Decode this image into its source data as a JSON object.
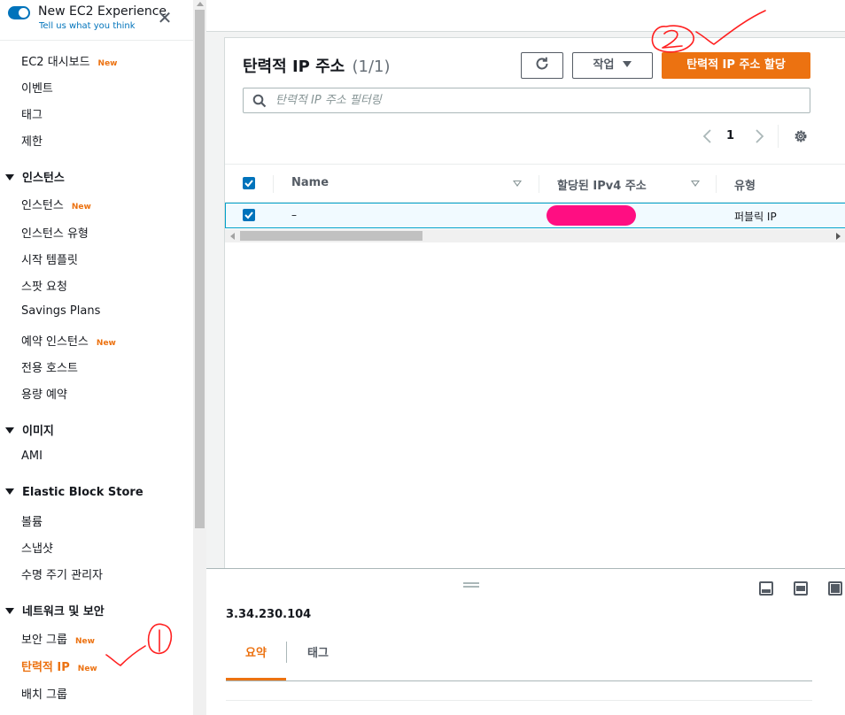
{
  "experience_toggle": {
    "title": "New EC2 Experience",
    "subtitle": "Tell us what you think"
  },
  "sidebar": {
    "items": [
      {
        "label": "EC2 대시보드",
        "badge": "New"
      },
      {
        "label": "이벤트",
        "badge": ""
      },
      {
        "label": "태그",
        "badge": ""
      },
      {
        "label": "제한",
        "badge": ""
      },
      {
        "label": "인스턴스",
        "badge": "",
        "section": true
      },
      {
        "label": "인스턴스",
        "badge": "New"
      },
      {
        "label": "인스턴스 유형",
        "badge": ""
      },
      {
        "label": "시작 템플릿",
        "badge": ""
      },
      {
        "label": "스팟 요청",
        "badge": ""
      },
      {
        "label": "Savings Plans",
        "badge": ""
      },
      {
        "label": "예약 인스턴스",
        "badge": "New"
      },
      {
        "label": "전용 호스트",
        "badge": ""
      },
      {
        "label": "용량 예약",
        "badge": ""
      },
      {
        "label": "이미지",
        "badge": "",
        "section": true
      },
      {
        "label": "AMI",
        "badge": ""
      },
      {
        "label": "Elastic Block Store",
        "badge": "",
        "section": true
      },
      {
        "label": "볼륨",
        "badge": ""
      },
      {
        "label": "스냅샷",
        "badge": ""
      },
      {
        "label": "수명 주기 관리자",
        "badge": ""
      },
      {
        "label": "네트워크 및 보안",
        "badge": "",
        "section": true
      },
      {
        "label": "보안 그룹",
        "badge": "New"
      },
      {
        "label": "탄력적 IP",
        "badge": "New",
        "active": true
      },
      {
        "label": "배치 그룹",
        "badge": ""
      }
    ]
  },
  "main": {
    "title": "탄력적 IP 주소",
    "count": "(1/1)",
    "actions_label": "작업",
    "allocate_label": "탄력적 IP 주소 할당",
    "search_placeholder": "탄력적 IP 주소 필터링",
    "page_number": "1",
    "table": {
      "columns": [
        "Name",
        "할당된 IPv4 주소",
        "유형"
      ],
      "rows": [
        {
          "name": "–",
          "ipv4": "",
          "type": "퍼블릭 IP",
          "selected": true
        }
      ]
    }
  },
  "split_panel": {
    "title": "3.34.230.104",
    "tabs": [
      "요약",
      "태그"
    ],
    "active_tab": "요약"
  },
  "colors": {
    "accent": "#ec7211",
    "link": "#0073bb",
    "redaction": "#ff0e82",
    "annotation": "#ff0000"
  },
  "icons": [
    "close-icon",
    "refresh-icon",
    "caret-down-icon",
    "search-icon",
    "chevron-left-icon",
    "chevron-right-icon",
    "gear-icon",
    "check-icon",
    "sort-icon"
  ]
}
